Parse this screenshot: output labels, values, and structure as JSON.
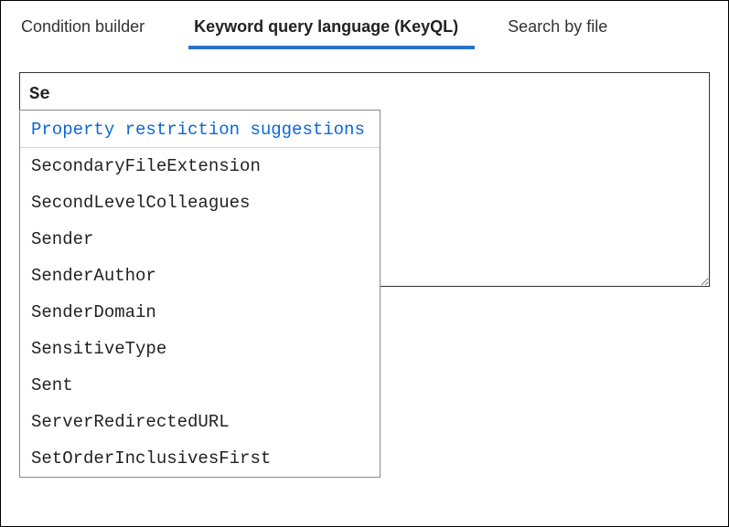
{
  "tabs": {
    "condition_builder": {
      "label": "Condition builder",
      "active": false
    },
    "keyql": {
      "label": "Keyword query language (KeyQL)",
      "active": true
    },
    "search_by_file": {
      "label": "Search by file",
      "active": false
    }
  },
  "query": {
    "value": "Se"
  },
  "suggestions": {
    "header": "Property restriction suggestions",
    "items": [
      "SecondaryFileExtension",
      "SecondLevelColleagues",
      "Sender",
      "SenderAuthor",
      "SenderDomain",
      "SensitiveType",
      "Sent",
      "ServerRedirectedURL",
      "SetOrderInclusivesFirst"
    ]
  }
}
